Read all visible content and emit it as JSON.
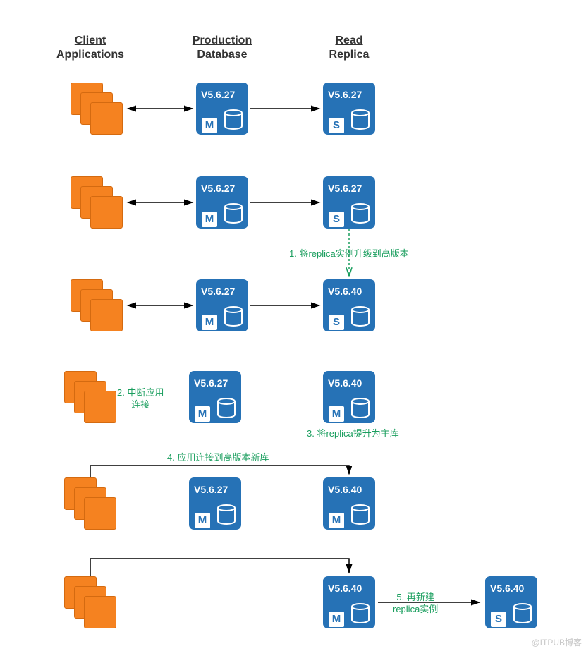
{
  "headers": {
    "client": "Client\nApplications",
    "prod": "Production\nDatabase",
    "replica": "Read\nReplica"
  },
  "versions": {
    "v27": "V5.6.27",
    "v40": "V5.6.40"
  },
  "roles": {
    "master": "M",
    "slave": "S"
  },
  "notes": {
    "n1": "1. 将replica实例升级到高版本",
    "n2": "2. 中断应用\n连接",
    "n3": "3. 将replica提升为主库",
    "n4": "4. 应用连接到高版本新库",
    "n5": "5. 再新建\nreplica实例"
  },
  "watermark": "@ITPUB博客",
  "chart_data": {
    "type": "diagram",
    "title": "RDS MySQL minor-version upgrade via Read Replica promotion",
    "columns": [
      "Client Applications",
      "Production Database",
      "Read Replica"
    ],
    "steps": [
      {
        "step": 0,
        "client": {
          "connected_to": "production"
        },
        "production": {
          "version": "V5.6.27",
          "role": "M"
        },
        "replica": {
          "version": "V5.6.27",
          "role": "S"
        },
        "replication": "production -> replica"
      },
      {
        "step": 1,
        "label": "1. 将replica实例升级到高版本",
        "client": {
          "connected_to": "production"
        },
        "production": {
          "version": "V5.6.27",
          "role": "M"
        },
        "replica": {
          "version": "V5.6.27 → V5.6.40",
          "role": "S"
        }
      },
      {
        "step": 2,
        "client": {
          "connected_to": "production"
        },
        "production": {
          "version": "V5.6.27",
          "role": "M"
        },
        "replica": {
          "version": "V5.6.40",
          "role": "S"
        }
      },
      {
        "step": 3,
        "labels": [
          "2. 中断应用连接",
          "3. 将replica提升为主库"
        ],
        "client": {
          "connected_to": null
        },
        "production": {
          "version": "V5.6.27",
          "role": "M"
        },
        "replica": {
          "version": "V5.6.40",
          "role": "M"
        }
      },
      {
        "step": 4,
        "label": "4. 应用连接到高版本新库",
        "client": {
          "connected_to": "replica (promoted)"
        },
        "old_production": {
          "version": "V5.6.27",
          "role": "M"
        },
        "new_production": {
          "version": "V5.6.40",
          "role": "M"
        }
      },
      {
        "step": 5,
        "label": "5. 再新建replica实例",
        "client": {
          "connected_to": "new production"
        },
        "new_production": {
          "version": "V5.6.40",
          "role": "M"
        },
        "new_replica": {
          "version": "V5.6.40",
          "role": "S"
        }
      }
    ]
  }
}
